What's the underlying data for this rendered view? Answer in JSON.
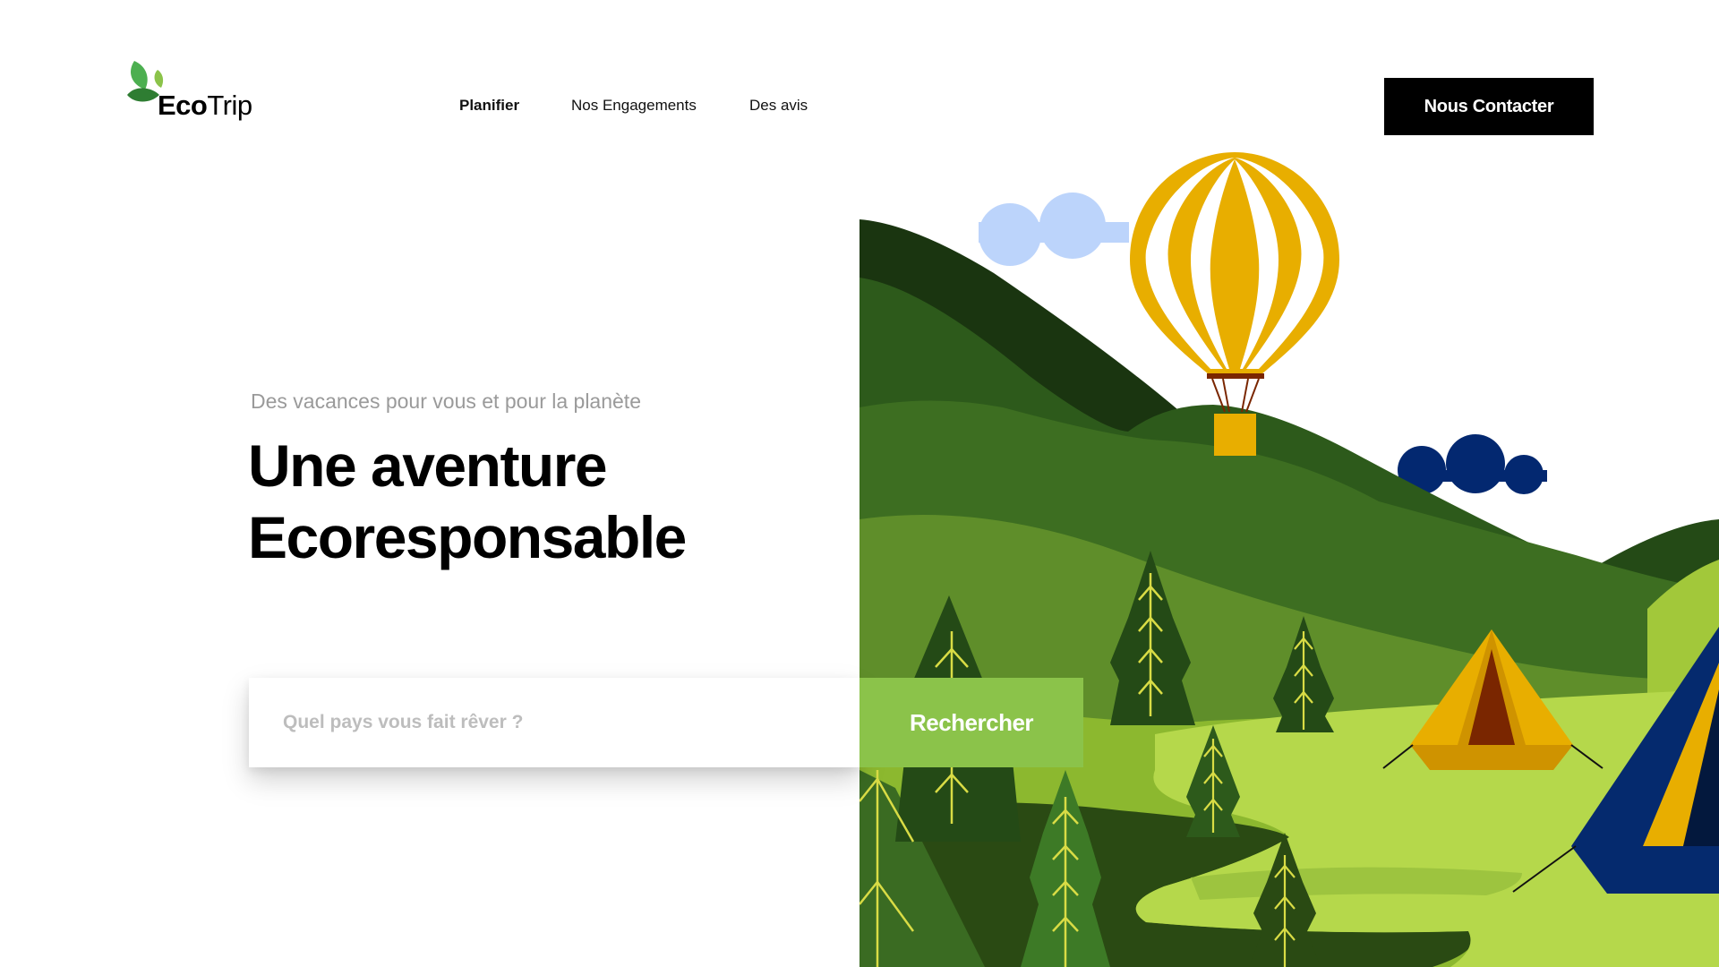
{
  "brand": {
    "name_bold": "Eco",
    "name_regular": "Trip"
  },
  "nav": {
    "items": [
      {
        "label": "Planifier",
        "active": true
      },
      {
        "label": "Nos Engagements",
        "active": false
      },
      {
        "label": "Des avis",
        "active": false
      }
    ]
  },
  "header": {
    "contact_label": "Nous Contacter"
  },
  "hero": {
    "subtitle": "Des vacances pour vous et pour la planète",
    "title_line1": "Une aventure",
    "title_line2": "Ecoresponsable"
  },
  "search": {
    "placeholder": "Quel pays vous fait rêver ?",
    "value": "",
    "button_label": "Rechercher"
  },
  "colors": {
    "accent_green": "#8bc34a",
    "dark": "#000000",
    "balloon_yellow": "#e8ae00",
    "tent_blue": "#052a6e"
  },
  "icons": {
    "logo": "leaf-icon"
  }
}
